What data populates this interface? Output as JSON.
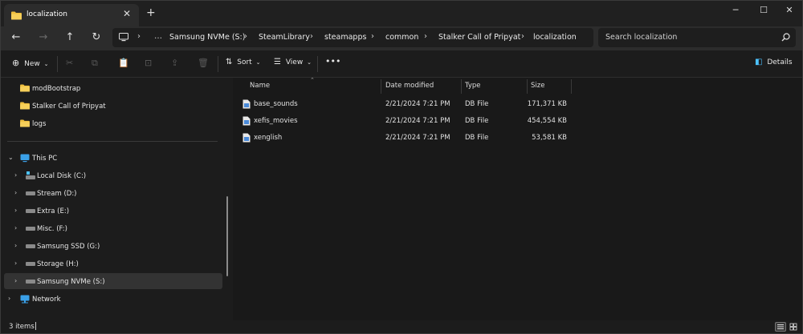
{
  "window": {
    "tab_title": "localization"
  },
  "address": {
    "crumbs": [
      "Samsung NVMe (S:)",
      "SteamLibrary",
      "steamapps",
      "common",
      "Stalker Call of Pripyat",
      "localization"
    ]
  },
  "search": {
    "placeholder": "Search localization"
  },
  "toolbar": {
    "new_label": "New",
    "sort_label": "Sort",
    "view_label": "View",
    "details_label": "Details"
  },
  "sidebar": {
    "folders": [
      {
        "label": "modBootstrap"
      },
      {
        "label": "Stalker Call of Pripyat"
      },
      {
        "label": "logs"
      }
    ],
    "this_pc": "This PC",
    "drives": [
      {
        "label": "Local Disk (C:)"
      },
      {
        "label": "Stream (D:)"
      },
      {
        "label": "Extra (E:)"
      },
      {
        "label": "Misc. (F:)"
      },
      {
        "label": "Samsung SSD (G:)"
      },
      {
        "label": "Storage (H:)"
      },
      {
        "label": "Samsung NVMe (S:)"
      }
    ],
    "network": "Network"
  },
  "list": {
    "columns": {
      "name": "Name",
      "date": "Date modified",
      "type": "Type",
      "size": "Size"
    },
    "files": [
      {
        "name": "base_sounds",
        "date": "2/21/2024 7:21 PM",
        "type": "DB File",
        "size": "171,371 KB"
      },
      {
        "name": "xefis_movies",
        "date": "2/21/2024 7:21 PM",
        "type": "DB File",
        "size": "454,554 KB"
      },
      {
        "name": "xenglish",
        "date": "2/21/2024 7:21 PM",
        "type": "DB File",
        "size": "53,581 KB"
      }
    ]
  },
  "status": {
    "item_count": "3 items"
  },
  "colors": {
    "folder": "#f0c040",
    "accent": "#4cc2ff",
    "bg": "#1c1c1c"
  }
}
